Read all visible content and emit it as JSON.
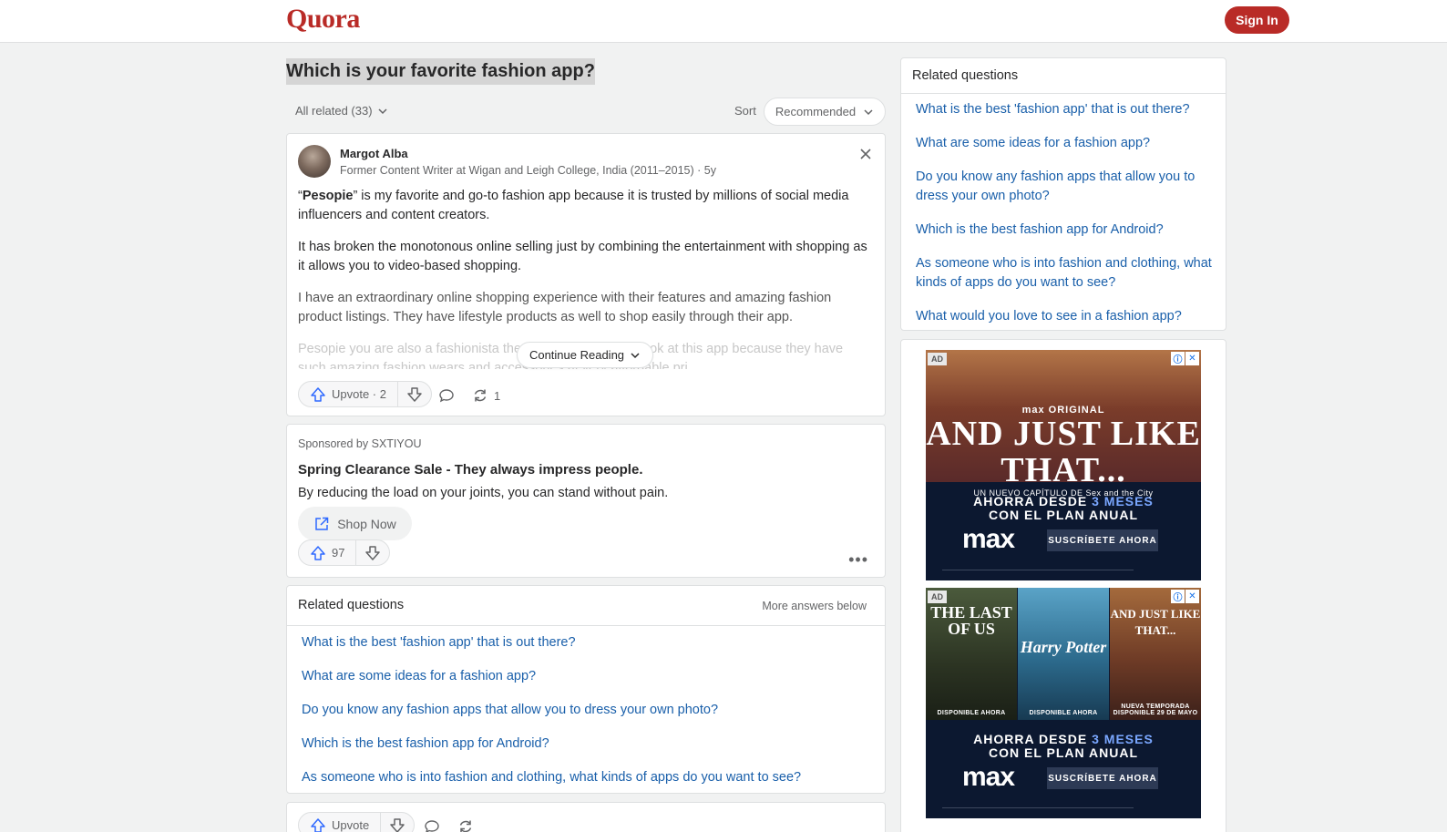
{
  "header": {
    "logo": "Quora",
    "sign_in": "Sign In"
  },
  "question": {
    "title": "Which is your favorite fashion app?"
  },
  "filter": {
    "all_related": "All related (33)",
    "sort_label": "Sort",
    "sort_value": "Recommended"
  },
  "answer": {
    "author": "Margot Alba",
    "credential": "Former Content Writer at Wigan and Leigh College, India (2011–2015) · 5y",
    "p1_open": "“",
    "p1_bold": "Pesopie",
    "p1_rest": "” is my favorite and go-to fashion app because it is trusted by millions of social media influencers and content creators.",
    "p2": "It has broken the monotonous online selling just by combining the entertainment with shopping as it allows you to video-based shopping.",
    "p3": "I have an extraordinary online shopping experience with their features and amazing fashion product listings. They have lifestyle products as well to shop easily through their app.",
    "p4": "Pesopie you are also a fashionista then you should take a look at this app because they have such amazing fashion wears and accessories at very affordable pri",
    "continue_reading": "Continue Reading",
    "upvote_label": "Upvote · 2",
    "share_count": "1"
  },
  "sponsored": {
    "by": "Sponsored by SXTIYOU",
    "title": "Spring Clearance Sale - They always impress people.",
    "description": "By reducing the load on your joints, you can stand without pain.",
    "cta": "Shop Now",
    "upvotes": "97"
  },
  "related_main": {
    "heading": "Related questions",
    "more_below": "More answers below",
    "items": [
      "What is the best 'fashion app' that is out there?",
      "What are some ideas for a fashion app?",
      "Do you know any fashion apps that allow you to dress your own photo?",
      "Which is the best fashion app for Android?",
      "As someone who is into fashion and clothing, what kinds of apps do you want to see?"
    ]
  },
  "next_card": {
    "upvote_label": "Upvote"
  },
  "related_side": {
    "heading": "Related questions",
    "items": [
      "What is the best 'fashion app' that is out there?",
      "What are some ideas for a fashion app?",
      "Do you know any fashion apps that allow you to dress your own photo?",
      "Which is the best fashion app for Android?",
      "As someone who is into fashion and clothing, what kinds of apps do you want to see?",
      "What would you love to see in a fashion app?"
    ]
  },
  "ads": {
    "tag": "AD",
    "ad1": {
      "brand_line": "max ORIGINAL",
      "headline": "AND JUST LIKE THAT...",
      "subline": "UN NUEVO CAPÍTULO DE Sex and the City",
      "offer_line1": "AHORRA DESDE",
      "offer_highlight": "3 MESES",
      "offer_line2": "CON EL PLAN ANUAL",
      "logo": "max",
      "cta": "SUSCRÍBETE AHORA"
    },
    "ad2": {
      "posters": [
        {
          "title": "THE LAST OF US",
          "caption": "DISPONIBLE AHORA"
        },
        {
          "title": "Harry Potter",
          "caption": "DISPONIBLE AHORA"
        },
        {
          "title": "AND JUST LIKE THAT...",
          "caption": "NUEVA TEMPORADA DISPONIBLE 29 DE MAYO"
        }
      ],
      "offer_line1": "AHORRA DESDE",
      "offer_highlight": "3 MESES",
      "offer_line2": "CON EL PLAN ANUAL",
      "logo": "max",
      "cta": "SUSCRÍBETE AHORA"
    }
  },
  "colors": {
    "brand": "#b92b27",
    "link": "#195faa",
    "background": "#f1f2f2"
  }
}
